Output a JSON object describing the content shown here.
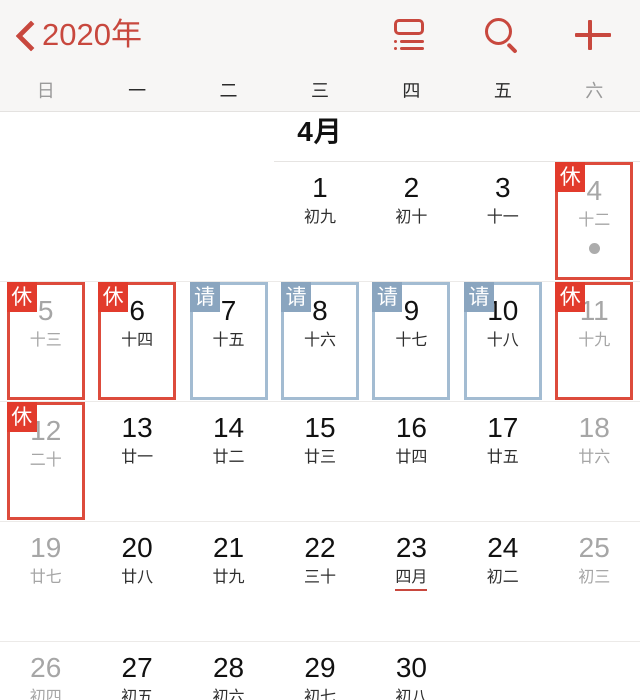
{
  "header": {
    "back_icon": "chevron-left-icon",
    "year_label": "2020年",
    "agenda_icon": "agenda-view-icon",
    "search_icon": "search-icon",
    "add_icon": "plus-icon",
    "accent_color": "#c8483e"
  },
  "weekdays": [
    {
      "label": "日",
      "dim": true
    },
    {
      "label": "一",
      "dim": false
    },
    {
      "label": "二",
      "dim": false
    },
    {
      "label": "三",
      "dim": false
    },
    {
      "label": "四",
      "dim": false
    },
    {
      "label": "五",
      "dim": false
    },
    {
      "label": "六",
      "dim": true
    }
  ],
  "month": {
    "title": "4月"
  },
  "legend": {
    "rest_badge": "休",
    "work_badge": "请",
    "rest_color": "#e23b2c",
    "work_color": "#8aa5bf",
    "rest_border": "#dd4b3c",
    "work_border": "#a3bcd2",
    "event_dot_color": "#acacac"
  },
  "weeks": [
    [
      {
        "empty": true
      },
      {
        "empty": true
      },
      {
        "empty": true
      },
      {
        "day": "1",
        "lunar": "初九",
        "dim": false,
        "badge": "",
        "box": "",
        "dot": false
      },
      {
        "day": "2",
        "lunar": "初十",
        "dim": false,
        "badge": "",
        "box": "",
        "dot": false
      },
      {
        "day": "3",
        "lunar": "十一",
        "dim": false,
        "badge": "",
        "box": "",
        "dot": false
      },
      {
        "day": "4",
        "lunar": "十二",
        "dim": true,
        "badge": "休",
        "box": "red",
        "dot": true
      }
    ],
    [
      {
        "day": "5",
        "lunar": "十三",
        "dim": true,
        "badge": "休",
        "box": "red",
        "dot": false
      },
      {
        "day": "6",
        "lunar": "十四",
        "dim": false,
        "badge": "休",
        "box": "red",
        "dot": false
      },
      {
        "day": "7",
        "lunar": "十五",
        "dim": false,
        "badge": "请",
        "box": "blue",
        "dot": false
      },
      {
        "day": "8",
        "lunar": "十六",
        "dim": false,
        "badge": "请",
        "box": "blue",
        "dot": false
      },
      {
        "day": "9",
        "lunar": "十七",
        "dim": false,
        "badge": "请",
        "box": "blue",
        "dot": false
      },
      {
        "day": "10",
        "lunar": "十八",
        "dim": false,
        "badge": "请",
        "box": "blue",
        "dot": false
      },
      {
        "day": "11",
        "lunar": "十九",
        "dim": true,
        "badge": "休",
        "box": "red",
        "dot": false
      }
    ],
    [
      {
        "day": "12",
        "lunar": "二十",
        "dim": true,
        "badge": "休",
        "box": "red",
        "dot": false
      },
      {
        "day": "13",
        "lunar": "廿一",
        "dim": false,
        "badge": "",
        "box": "",
        "dot": false
      },
      {
        "day": "14",
        "lunar": "廿二",
        "dim": false,
        "badge": "",
        "box": "",
        "dot": false
      },
      {
        "day": "15",
        "lunar": "廿三",
        "dim": false,
        "badge": "",
        "box": "",
        "dot": false
      },
      {
        "day": "16",
        "lunar": "廿四",
        "dim": false,
        "badge": "",
        "box": "",
        "dot": false
      },
      {
        "day": "17",
        "lunar": "廿五",
        "dim": false,
        "badge": "",
        "box": "",
        "dot": false
      },
      {
        "day": "18",
        "lunar": "廿六",
        "dim": true,
        "badge": "",
        "box": "",
        "dot": false
      }
    ],
    [
      {
        "day": "19",
        "lunar": "廿七",
        "dim": true,
        "badge": "",
        "box": "",
        "dot": false
      },
      {
        "day": "20",
        "lunar": "廿八",
        "dim": false,
        "badge": "",
        "box": "",
        "dot": false
      },
      {
        "day": "21",
        "lunar": "廿九",
        "dim": false,
        "badge": "",
        "box": "",
        "dot": false
      },
      {
        "day": "22",
        "lunar": "三十",
        "dim": false,
        "badge": "",
        "box": "",
        "dot": false
      },
      {
        "day": "23",
        "lunar": "四月",
        "dim": false,
        "badge": "",
        "box": "",
        "dot": false,
        "lunar_underline": true
      },
      {
        "day": "24",
        "lunar": "初二",
        "dim": false,
        "badge": "",
        "box": "",
        "dot": false
      },
      {
        "day": "25",
        "lunar": "初三",
        "dim": true,
        "badge": "",
        "box": "",
        "dot": false
      }
    ],
    [
      {
        "day": "26",
        "lunar": "初四",
        "dim": true,
        "badge": "",
        "box": "",
        "dot": false
      },
      {
        "day": "27",
        "lunar": "初五",
        "dim": false,
        "badge": "",
        "box": "",
        "dot": false
      },
      {
        "day": "28",
        "lunar": "初六",
        "dim": false,
        "badge": "",
        "box": "",
        "dot": false
      },
      {
        "day": "29",
        "lunar": "初七",
        "dim": false,
        "badge": "",
        "box": "",
        "dot": false
      },
      {
        "day": "30",
        "lunar": "初八",
        "dim": false,
        "badge": "",
        "box": "",
        "dot": false
      },
      {
        "empty": true
      },
      {
        "empty": true
      }
    ]
  ]
}
